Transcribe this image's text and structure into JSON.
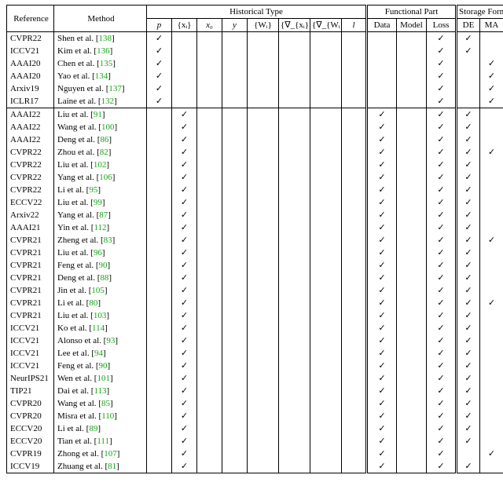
{
  "chart_data": {
    "type": "table",
    "title": "",
    "header_groups": {
      "reference": "Reference",
      "method": "Method",
      "historical_type": "Historical Type",
      "functional_part": "Functional Part",
      "storage_form": "Storage Form"
    },
    "historical_type_cols": [
      "p",
      "{xᵢ}",
      "x₀",
      "y",
      "{Wᵢ}",
      "{∇_{xᵢ}}",
      "{∇_{Wᵢ}}",
      "l"
    ],
    "functional_part_cols": [
      "Data",
      "Model",
      "Loss"
    ],
    "storage_form_cols": [
      "DE",
      "MA"
    ],
    "tick": "✓",
    "rows": [
      {
        "reference": "CVPR22",
        "author": "Shen et al.",
        "cite": "138",
        "hist": {
          "p": true
        },
        "fp": {
          "loss": true
        },
        "sf": {
          "de": true
        }
      },
      {
        "reference": "ICCV21",
        "author": "Kim et al.",
        "cite": "136",
        "hist": {
          "p": true
        },
        "fp": {
          "loss": true
        },
        "sf": {
          "de": true
        }
      },
      {
        "reference": "AAAI20",
        "author": "Chen et al.",
        "cite": "135",
        "hist": {
          "p": true
        },
        "fp": {
          "loss": true
        },
        "sf": {
          "ma": true
        }
      },
      {
        "reference": "AAAI20",
        "author": "Yao et al.",
        "cite": "134",
        "hist": {
          "p": true
        },
        "fp": {
          "loss": true
        },
        "sf": {
          "ma": true
        }
      },
      {
        "reference": "Arxiv19",
        "author": "Nguyen et al.",
        "cite": "137",
        "hist": {
          "p": true
        },
        "fp": {
          "loss": true
        },
        "sf": {
          "ma": true
        }
      },
      {
        "reference": "ICLR17",
        "author": "Laine et al.",
        "cite": "132",
        "hist": {
          "p": true
        },
        "fp": {
          "loss": true
        },
        "sf": {
          "ma": true
        },
        "sep_after": true
      },
      {
        "reference": "AAAI22",
        "author": "Liu et al.",
        "cite": "91",
        "hist": {
          "xi": true
        },
        "fp": {
          "data": true,
          "loss": true
        },
        "sf": {
          "de": true
        }
      },
      {
        "reference": "AAAI22",
        "author": "Wang et al.",
        "cite": "100",
        "hist": {
          "xi": true
        },
        "fp": {
          "data": true,
          "loss": true
        },
        "sf": {
          "de": true
        }
      },
      {
        "reference": "AAAI22",
        "author": "Deng et al.",
        "cite": "86",
        "hist": {
          "xi": true
        },
        "fp": {
          "data": true,
          "loss": true
        },
        "sf": {
          "de": true
        }
      },
      {
        "reference": "CVPR22",
        "author": "Zhou et al.",
        "cite": "82",
        "hist": {
          "xi": true
        },
        "fp": {
          "data": true,
          "loss": true
        },
        "sf": {
          "de": true,
          "ma": true
        }
      },
      {
        "reference": "CVPR22",
        "author": "Liu et al.",
        "cite": "102",
        "hist": {
          "xi": true
        },
        "fp": {
          "data": true,
          "loss": true
        },
        "sf": {
          "de": true
        }
      },
      {
        "reference": "CVPR22",
        "author": "Yang et al.",
        "cite": "106",
        "hist": {
          "xi": true
        },
        "fp": {
          "data": true,
          "loss": true
        },
        "sf": {
          "de": true
        }
      },
      {
        "reference": "CVPR22",
        "author": "Li et al.",
        "cite": "95",
        "hist": {
          "xi": true
        },
        "fp": {
          "data": true,
          "loss": true
        },
        "sf": {
          "de": true
        }
      },
      {
        "reference": "ECCV22",
        "author": "Liu et al.",
        "cite": "99",
        "hist": {
          "xi": true
        },
        "fp": {
          "data": true,
          "loss": true
        },
        "sf": {
          "de": true
        }
      },
      {
        "reference": "Arxiv22",
        "author": "Yang et al.",
        "cite": "87",
        "hist": {
          "xi": true
        },
        "fp": {
          "data": true,
          "loss": true
        },
        "sf": {
          "de": true
        }
      },
      {
        "reference": "AAAI21",
        "author": "Yin et al.",
        "cite": "112",
        "hist": {
          "xi": true
        },
        "fp": {
          "data": true,
          "loss": true
        },
        "sf": {
          "de": true
        }
      },
      {
        "reference": "CVPR21",
        "author": "Zheng et al.",
        "cite": "83",
        "hist": {
          "xi": true
        },
        "fp": {
          "data": true,
          "loss": true
        },
        "sf": {
          "de": true,
          "ma": true
        }
      },
      {
        "reference": "CVPR21",
        "author": "Liu et al.",
        "cite": "96",
        "hist": {
          "xi": true
        },
        "fp": {
          "data": true,
          "loss": true
        },
        "sf": {
          "de": true
        }
      },
      {
        "reference": "CVPR21",
        "author": "Feng et al.",
        "cite": "90",
        "hist": {
          "xi": true
        },
        "fp": {
          "data": true,
          "loss": true
        },
        "sf": {
          "de": true
        }
      },
      {
        "reference": "CVPR21",
        "author": "Deng et al.",
        "cite": "88",
        "hist": {
          "xi": true
        },
        "fp": {
          "data": true,
          "loss": true
        },
        "sf": {
          "de": true
        }
      },
      {
        "reference": "CVPR21",
        "author": "Jin et al.",
        "cite": "105",
        "hist": {
          "xi": true
        },
        "fp": {
          "data": true,
          "loss": true
        },
        "sf": {
          "de": true
        }
      },
      {
        "reference": "CVPR21",
        "author": "Li et al.",
        "cite": "80",
        "hist": {
          "xi": true
        },
        "fp": {
          "data": true,
          "loss": true
        },
        "sf": {
          "de": true,
          "ma": true
        }
      },
      {
        "reference": "CVPR21",
        "author": "Liu et al.",
        "cite": "103",
        "hist": {
          "xi": true
        },
        "fp": {
          "data": true,
          "loss": true
        },
        "sf": {
          "de": true
        }
      },
      {
        "reference": "ICCV21",
        "author": "Ko et al.",
        "cite": "114",
        "hist": {
          "xi": true
        },
        "fp": {
          "data": true,
          "loss": true
        },
        "sf": {
          "de": true
        }
      },
      {
        "reference": "ICCV21",
        "author": "Alonso et al.",
        "cite": "93",
        "hist": {
          "xi": true
        },
        "fp": {
          "data": true,
          "loss": true
        },
        "sf": {
          "de": true
        }
      },
      {
        "reference": "ICCV21",
        "author": "Lee et al.",
        "cite": "94",
        "hist": {
          "xi": true
        },
        "fp": {
          "data": true,
          "loss": true
        },
        "sf": {
          "de": true
        }
      },
      {
        "reference": "ICCV21",
        "author": "Feng et al.",
        "cite": "90",
        "hist": {
          "xi": true
        },
        "fp": {
          "data": true,
          "loss": true
        },
        "sf": {
          "de": true
        }
      },
      {
        "reference": "NeurIPS21",
        "author": "Wen et al.",
        "cite": "101",
        "hist": {
          "xi": true
        },
        "fp": {
          "data": true,
          "loss": true
        },
        "sf": {
          "de": true
        }
      },
      {
        "reference": "TIP21",
        "author": "Dai et al.",
        "cite": "113",
        "hist": {
          "xi": true
        },
        "fp": {
          "data": true,
          "loss": true
        },
        "sf": {
          "de": true
        }
      },
      {
        "reference": "CVPR20",
        "author": "Wang et al.",
        "cite": "85",
        "hist": {
          "xi": true
        },
        "fp": {
          "data": true,
          "loss": true
        },
        "sf": {
          "de": true
        }
      },
      {
        "reference": "CVPR20",
        "author": "Misra et al.",
        "cite": "110",
        "hist": {
          "xi": true
        },
        "fp": {
          "data": true,
          "loss": true
        },
        "sf": {
          "de": true
        }
      },
      {
        "reference": "ECCV20",
        "author": "Li et al.",
        "cite": "89",
        "hist": {
          "xi": true
        },
        "fp": {
          "data": true,
          "loss": true
        },
        "sf": {
          "de": true
        }
      },
      {
        "reference": "ECCV20",
        "author": "Tian et al.",
        "cite": "111",
        "hist": {
          "xi": true
        },
        "fp": {
          "data": true,
          "loss": true
        },
        "sf": {
          "de": true
        }
      },
      {
        "reference": "CVPR19",
        "author": "Zhong et al.",
        "cite": "107",
        "hist": {
          "xi": true
        },
        "fp": {
          "data": true,
          "loss": true
        },
        "sf": {
          "ma": true
        }
      },
      {
        "reference": "ICCV19",
        "author": "Zhuang et al.",
        "cite": "81",
        "hist": {
          "xi": true
        },
        "fp": {
          "data": true,
          "loss": true
        },
        "sf": {
          "de": true
        }
      }
    ]
  }
}
